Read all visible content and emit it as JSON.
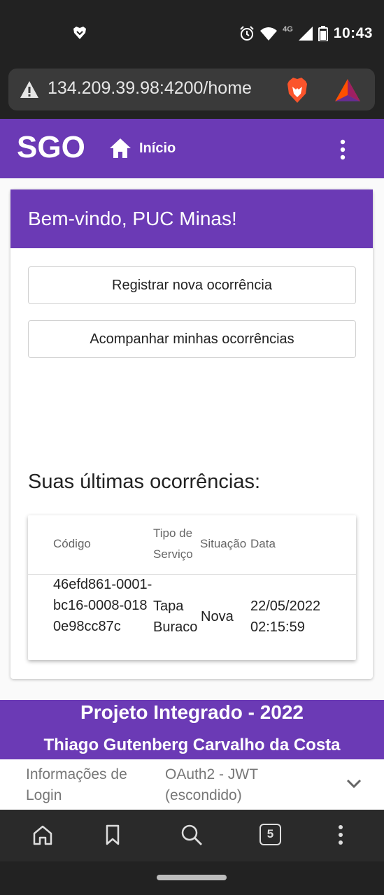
{
  "status_bar": {
    "time": "10:43",
    "network": "4G",
    "icons": [
      "brave-notification-icon",
      "alarm-icon",
      "wifi-icon",
      "signal-icon",
      "battery-icon"
    ]
  },
  "browser": {
    "url": "134.209.39.98:4200/home",
    "tab_count": "5",
    "icons": [
      "warning-icon",
      "brave-shield-icon",
      "bat-rewards-icon",
      "home-icon",
      "bookmark-icon",
      "search-icon",
      "tabs-icon",
      "more-icon"
    ]
  },
  "app_bar": {
    "brand": "SGO",
    "nav_home_label": "Início",
    "accent_color": "#6b3ab5"
  },
  "welcome": {
    "title": "Bem-vindo, PUC Minas!"
  },
  "actions": {
    "register_label": "Registrar nova ocorrência",
    "track_label": "Acompanhar minhas ocorrências"
  },
  "recent": {
    "title": "Suas últimas ocorrências:",
    "columns": {
      "code": "Código",
      "type": "Tipo de Serviço",
      "status": "Situação",
      "date": "Data"
    },
    "rows": [
      {
        "code": "46efd861-0001-bc16-0008-0180e98cc87c",
        "type": "Tapa Buraco",
        "status": "Nova",
        "date": "22/05/2022 02:15:59"
      }
    ]
  },
  "footer": {
    "title": "Projeto Integrado - 2022",
    "author": "Thiago Gutenberg Carvalho da Costa"
  },
  "info_strip": {
    "label": "Informações de Login",
    "value": "OAuth2 - JWT (escondido)"
  }
}
